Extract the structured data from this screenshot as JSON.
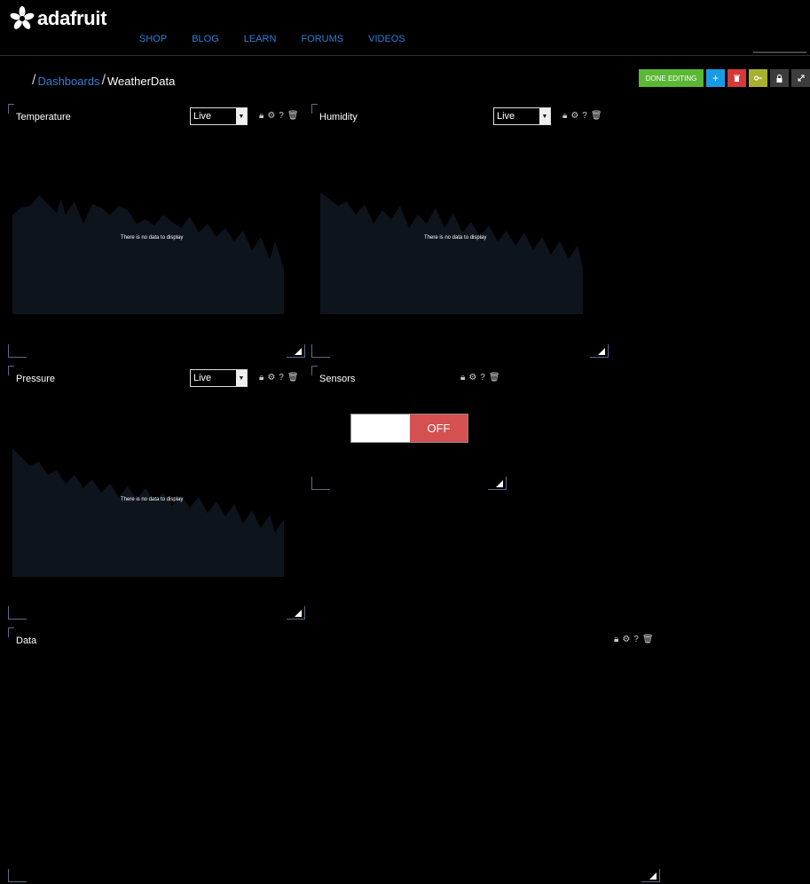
{
  "header": {
    "logo_text": "adafruit",
    "nav": [
      "SHOP",
      "BLOG",
      "LEARN",
      "FORUMS",
      "VIDEOS"
    ]
  },
  "breadcrumb": {
    "link": "Dashboards",
    "current": "WeatherData"
  },
  "toolbar": {
    "done_label": "DONE EDITING",
    "add_label": "+"
  },
  "blocks": {
    "temperature": {
      "title": "Temperature",
      "select_value": "Live",
      "empty_text": "There is no data to display"
    },
    "humidity": {
      "title": "Humidity",
      "select_value": "Live",
      "empty_text": "There is no data to display"
    },
    "pressure": {
      "title": "Pressure",
      "select_value": "Live",
      "empty_text": "There is no data to display"
    },
    "sensors": {
      "title": "Sensors",
      "toggle_label": "OFF"
    },
    "data": {
      "title": "Data"
    }
  },
  "icons": {
    "block_controls": [
      "lock-icon",
      "gear-icon",
      "help-icon",
      "trash-icon"
    ],
    "sensors_controls": [
      "lock-icon",
      "gear-icon",
      "help-icon",
      "trash-icon"
    ]
  },
  "colors": {
    "accent_link": "#2e7fd6",
    "done_button": "#5bb834",
    "add_button": "#1b9ae4",
    "delete_button": "#d33a3a",
    "key_button": "#a8b030",
    "toggle_off": "#d55050",
    "chart_fill": "#0e141c"
  }
}
